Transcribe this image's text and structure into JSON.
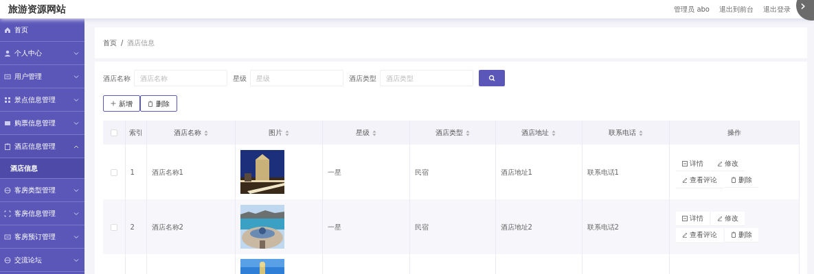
{
  "header": {
    "title": "旅游资源网站",
    "links": [
      "管理员 abo",
      "退出到前台",
      "退出登录"
    ]
  },
  "overlay_button": {
    "label": "›"
  },
  "sidebar": {
    "items": [
      {
        "label": "首页"
      },
      {
        "label": "个人中心",
        "expanded": false
      },
      {
        "label": "用户管理",
        "expanded": false
      },
      {
        "label": "景点信息管理",
        "expanded": false
      },
      {
        "label": "购票信息管理",
        "expanded": false
      },
      {
        "label": "酒店信息管理",
        "expanded": true,
        "children": [
          {
            "label": "酒店信息",
            "selected": true
          }
        ]
      },
      {
        "label": "客房类型管理",
        "expanded": false
      },
      {
        "label": "客房信息管理",
        "expanded": false
      },
      {
        "label": "客房预订管理",
        "expanded": false
      },
      {
        "label": "交流论坛",
        "expanded": false
      }
    ]
  },
  "breadcrumb": [
    "首页",
    "酒店信息"
  ],
  "breadcrumb_separator": "/",
  "search": {
    "fields": [
      {
        "label": "酒店名称",
        "placeholder": "酒店名称"
      },
      {
        "label": "星级",
        "placeholder": "星级"
      },
      {
        "label": "酒店类型",
        "placeholder": "酒店类型"
      }
    ]
  },
  "toolbar": [
    {
      "label": "新增",
      "kind": "add"
    },
    {
      "label": "删除",
      "kind": "delete"
    }
  ],
  "table": {
    "select_all": {
      "checked": false
    },
    "columns": [
      {
        "label": "索引",
        "sortable": false
      },
      {
        "label": "酒店名称",
        "sortable": true
      },
      {
        "label": "图片",
        "sortable": true
      },
      {
        "label": "星级",
        "sortable": true
      },
      {
        "label": "酒店类型",
        "sortable": true
      },
      {
        "label": "酒店地址",
        "sortable": true
      },
      {
        "label": "联系电话",
        "sortable": true
      },
      {
        "label": "操作",
        "sortable": false
      }
    ],
    "rows": [
      {
        "checked": false,
        "index": "1",
        "name": "酒店名称1",
        "picture": {
          "kind": "picture"
        },
        "star": "一星",
        "type": "民宿",
        "address": "酒店地址1",
        "phone": "联系电话1",
        "actions": [
          {
            "label": "详情",
            "kind": "detail"
          },
          {
            "label": "修改",
            "kind": "edit"
          },
          {
            "label": "查看评论",
            "kind": "edit"
          },
          {
            "label": "删除",
            "kind": "delete"
          }
        ]
      },
      {
        "checked": false,
        "index": "2",
        "name": "酒店名称2",
        "picture": {
          "kind": "picture"
        },
        "star": "一星",
        "type": "民宿",
        "address": "酒店地址2",
        "phone": "联系电话2",
        "actions": [
          {
            "label": "详情",
            "kind": "detail"
          },
          {
            "label": "修改",
            "kind": "edit"
          },
          {
            "label": "查看评论",
            "kind": "edit"
          },
          {
            "label": "删除",
            "kind": "delete"
          }
        ]
      },
      {
        "picture": {
          "kind": "picture"
        }
      }
    ]
  }
}
